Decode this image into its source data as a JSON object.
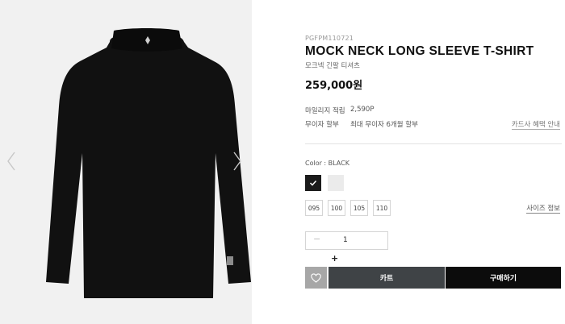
{
  "product": {
    "sku": "PGFPM110721",
    "title": "MOCK NECK LONG SLEEVE T-SHIRT",
    "subtitle": "모크넥 긴팔 티셔츠",
    "price": "259,000원"
  },
  "benefits": {
    "mileage_label": "마일리지 적립",
    "mileage_value": "2,590P",
    "installment_label": "무이자 할부",
    "installment_value": "최대 무이자 6개월 할부",
    "card_link": "카드사 혜택 안내"
  },
  "options": {
    "color_label": "Color : BLACK",
    "colors": [
      {
        "name": "BLACK",
        "hex": "#1b1b1b",
        "selected": true
      },
      {
        "name": "WHITE",
        "hex": "#ebebeb",
        "selected": false
      }
    ],
    "sizes": [
      "095",
      "100",
      "105",
      "110"
    ],
    "size_guide": "사이즈 정보"
  },
  "quantity": {
    "minus": "−",
    "value": "1",
    "plus": "+"
  },
  "actions": {
    "cart": "카트",
    "buy": "구매하기"
  },
  "gallery": {
    "background": "#f1f1f1",
    "shirt_color": "#111111"
  }
}
